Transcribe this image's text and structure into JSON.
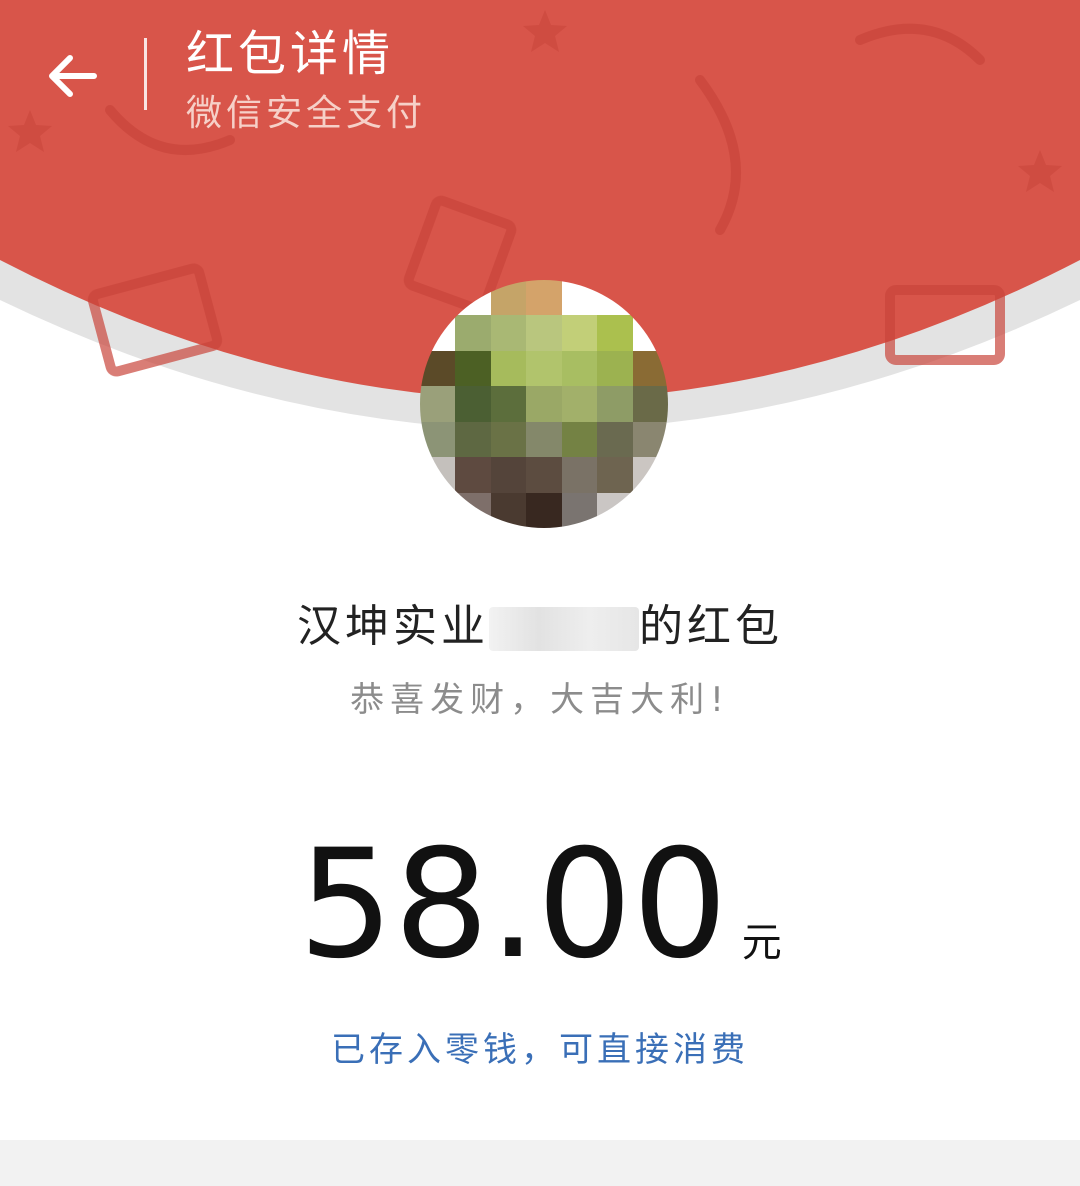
{
  "header": {
    "title": "红包详情",
    "subtitle": "微信安全支付",
    "back_icon": "back-arrow-icon"
  },
  "colors": {
    "banner_red": "#d8554a",
    "link_blue": "#3a6fb7"
  },
  "sender": {
    "name_prefix": "汉坤实业",
    "name_suffix": "的红包"
  },
  "greeting": "恭喜发财，大吉大利!",
  "amount": {
    "value": "58.00",
    "unit": "元"
  },
  "status_link": "已存入零钱，可直接消费"
}
